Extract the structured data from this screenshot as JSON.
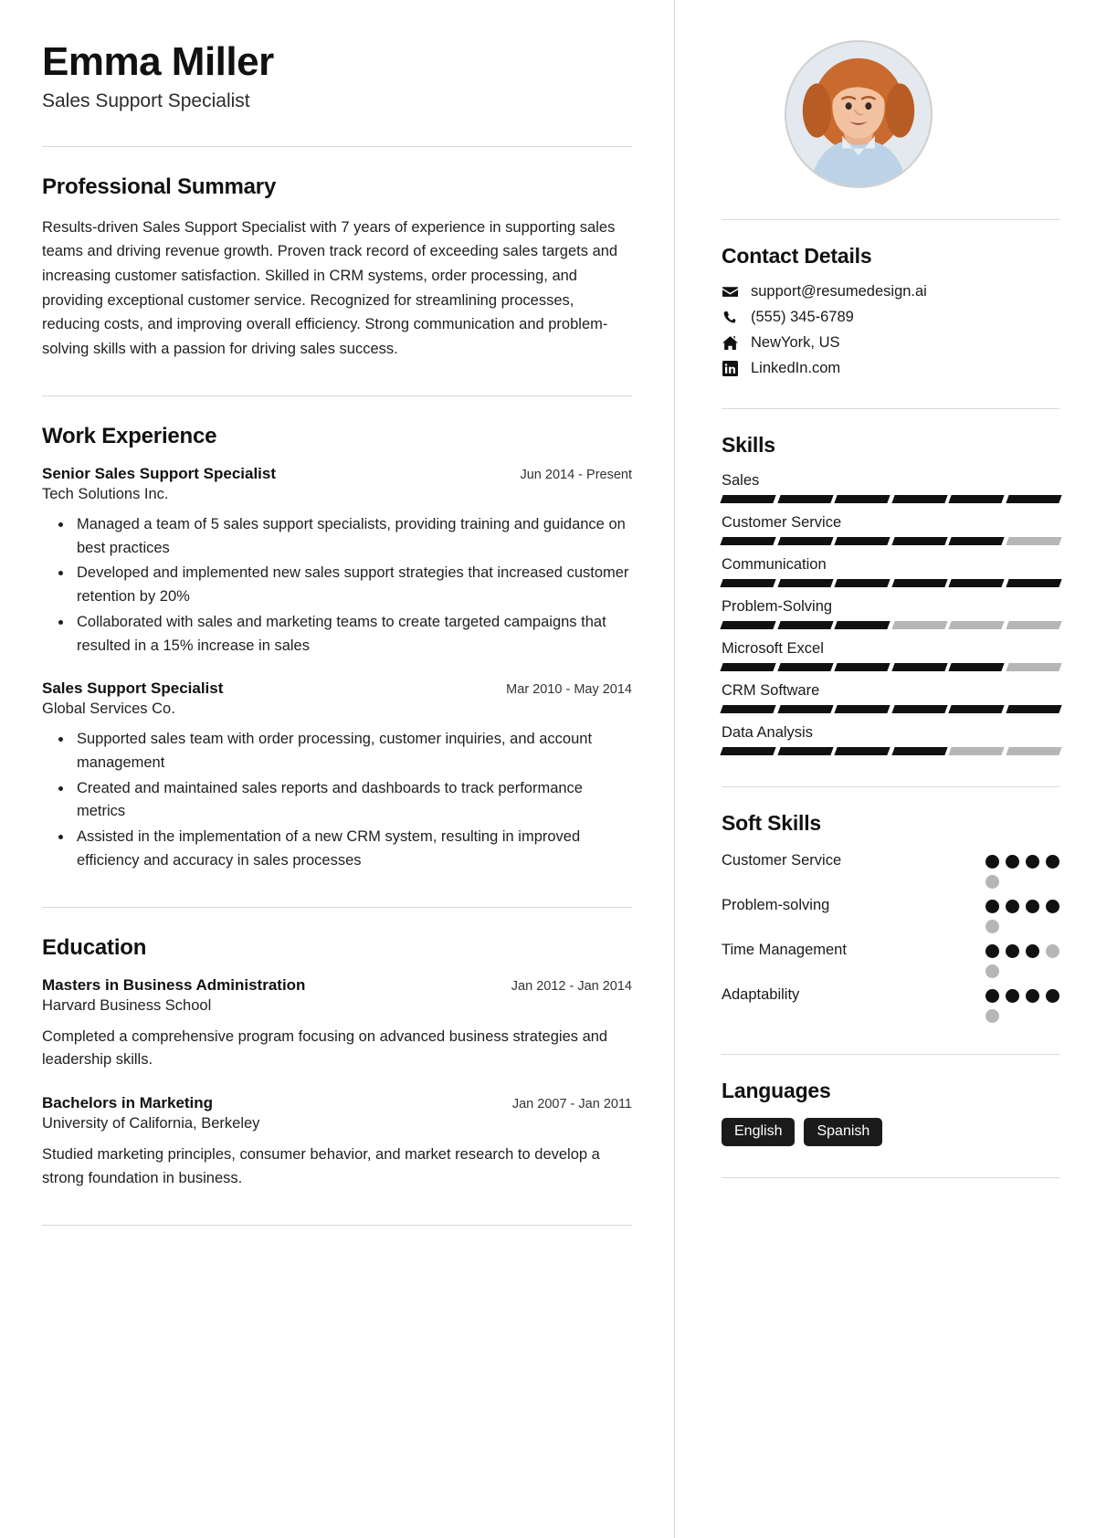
{
  "header": {
    "name": "Emma Miller",
    "job_title": "Sales Support Specialist"
  },
  "photo": {
    "alt_name": "profile-photo"
  },
  "summary": {
    "heading": "Professional Summary",
    "text": "Results-driven Sales Support Specialist with 7 years of experience in supporting sales teams and driving revenue growth. Proven track record of exceeding sales targets and increasing customer satisfaction. Skilled in CRM systems, order processing, and providing exceptional customer service. Recognized for streamlining processes, reducing costs, and improving overall efficiency. Strong communication and problem-solving skills with a passion for driving sales success."
  },
  "work": {
    "heading": "Work Experience",
    "entries": [
      {
        "role": "Senior Sales Support Specialist",
        "date": "Jun 2014 - Present",
        "org": "Tech Solutions Inc.",
        "bullets": [
          "Managed a team of 5 sales support specialists, providing training and guidance on best practices",
          "Developed and implemented new sales support strategies that increased customer retention by 20%",
          "Collaborated with sales and marketing teams to create targeted campaigns that resulted in a 15% increase in sales"
        ]
      },
      {
        "role": "Sales Support Specialist",
        "date": "Mar 2010 - May 2014",
        "org": "Global Services Co.",
        "bullets": [
          "Supported sales team with order processing, customer inquiries, and account management",
          "Created and maintained sales reports and dashboards to track performance metrics",
          "Assisted in the implementation of a new CRM system, resulting in improved efficiency and accuracy in sales processes"
        ]
      }
    ]
  },
  "education": {
    "heading": "Education",
    "entries": [
      {
        "degree": "Masters in Business Administration",
        "date": "Jan 2012 - Jan 2014",
        "school": "Harvard Business School",
        "description": "Completed a comprehensive program focusing on advanced business strategies and leadership skills."
      },
      {
        "degree": "Bachelors in Marketing",
        "date": "Jan 2007 - Jan 2011",
        "school": "University of California, Berkeley",
        "description": "Studied marketing principles, consumer behavior, and market research to develop a strong foundation in business."
      }
    ]
  },
  "contact": {
    "heading": "Contact Details",
    "items": [
      {
        "icon": "envelope-icon",
        "value": "support@resumedesign.ai"
      },
      {
        "icon": "phone-icon",
        "value": "(555) 345-6789"
      },
      {
        "icon": "home-icon",
        "value": "NewYork, US"
      },
      {
        "icon": "linkedin-icon",
        "value": "LinkedIn.com"
      }
    ]
  },
  "skills": {
    "heading": "Skills",
    "segments_total": 6,
    "items": [
      {
        "label": "Sales",
        "filled": 6
      },
      {
        "label": "Customer Service",
        "filled": 5
      },
      {
        "label": "Communication",
        "filled": 6
      },
      {
        "label": "Problem-Solving",
        "filled": 3
      },
      {
        "label": "Microsoft Excel",
        "filled": 5
      },
      {
        "label": "CRM Software",
        "filled": 6
      },
      {
        "label": "Data Analysis",
        "filled": 4
      }
    ]
  },
  "soft_skills": {
    "heading": "Soft Skills",
    "dots_total": 5,
    "items": [
      {
        "label": "Customer Service",
        "filled": 4
      },
      {
        "label": "Problem-solving",
        "filled": 4
      },
      {
        "label": "Time Management",
        "filled": 3
      },
      {
        "label": "Adaptability",
        "filled": 4
      }
    ]
  },
  "languages": {
    "heading": "Languages",
    "items": [
      "English",
      "Spanish"
    ]
  },
  "colors": {
    "accent": "#111111",
    "muted": "#b6b6b6",
    "divider": "#d9d9d9"
  }
}
